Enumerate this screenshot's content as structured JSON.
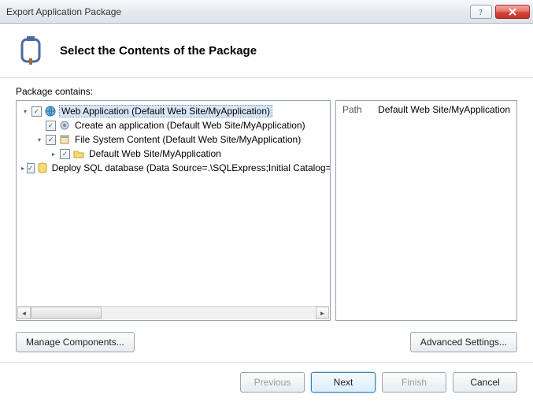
{
  "window": {
    "title": "Export Application Package"
  },
  "header": {
    "heading": "Select the Contents of the Package"
  },
  "content": {
    "label": "Package contains:",
    "tree": [
      {
        "depth": 0,
        "expander": "expanded",
        "checked": true,
        "icon": "globe-icon",
        "label": "Web Application (Default Web Site/MyApplication)",
        "selected": true
      },
      {
        "depth": 1,
        "expander": "none",
        "checked": true,
        "icon": "gear-icon",
        "label": "Create an application (Default Web Site/MyApplication)",
        "selected": false
      },
      {
        "depth": 1,
        "expander": "expanded",
        "checked": true,
        "icon": "filesystem-icon",
        "label": "File System Content (Default Web Site/MyApplication)",
        "selected": false
      },
      {
        "depth": 2,
        "expander": "collapsed",
        "checked": true,
        "icon": "folder-icon",
        "label": "Default Web Site/MyApplication",
        "selected": false
      },
      {
        "depth": 0,
        "expander": "collapsed",
        "checked": true,
        "icon": "database-icon",
        "label": "Deploy SQL database (Data Source=.\\SQLExpress;Initial Catalog=",
        "selected": false
      }
    ],
    "detail": {
      "key": "Path",
      "value": "Default Web Site/MyApplication"
    }
  },
  "buttons": {
    "manage": "Manage Components...",
    "advanced": "Advanced Settings...",
    "previous": "Previous",
    "next": "Next",
    "finish": "Finish",
    "cancel": "Cancel"
  }
}
